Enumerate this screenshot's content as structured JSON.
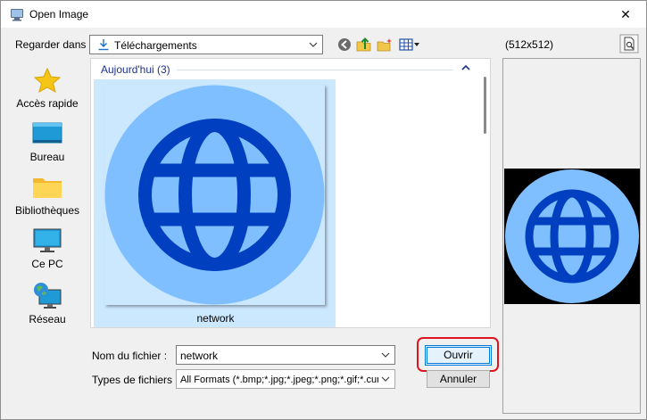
{
  "window": {
    "title": "Open Image",
    "close_glyph": "✕"
  },
  "toolbar": {
    "look_in_label": "Regarder dans :",
    "look_in_value": "Téléchargements",
    "icons": [
      "back-icon",
      "up-folder-icon",
      "new-folder-icon",
      "view-menu-icon"
    ]
  },
  "preview": {
    "dimensions": "(512x512)"
  },
  "places": [
    {
      "label": "Accès rapide",
      "icon": "star-icon"
    },
    {
      "label": "Bureau",
      "icon": "desktop-icon"
    },
    {
      "label": "Bibliothèques",
      "icon": "folder-icon"
    },
    {
      "label": "Ce PC",
      "icon": "monitor-icon"
    },
    {
      "label": "Réseau",
      "icon": "network-globe-icon"
    }
  ],
  "file_list": {
    "group_header": "Aujourd'hui (3)",
    "items": [
      {
        "name": "network",
        "selected": true
      }
    ]
  },
  "form": {
    "filename_label": "Nom du fichier :",
    "filename_value": "network",
    "filetype_label": "Types de fichiers :",
    "filetype_value": "All Formats (*.bmp;*.jpg;*.jpeg;*.png;*.gif;*.cur;*.ico)",
    "open_button": "Ouvrir",
    "cancel_button": "Annuler"
  },
  "colors": {
    "selection": "#cce8ff",
    "globe_light": "#7fbfff",
    "globe_dark": "#0040c0",
    "highlight_ring": "#e0141e"
  }
}
